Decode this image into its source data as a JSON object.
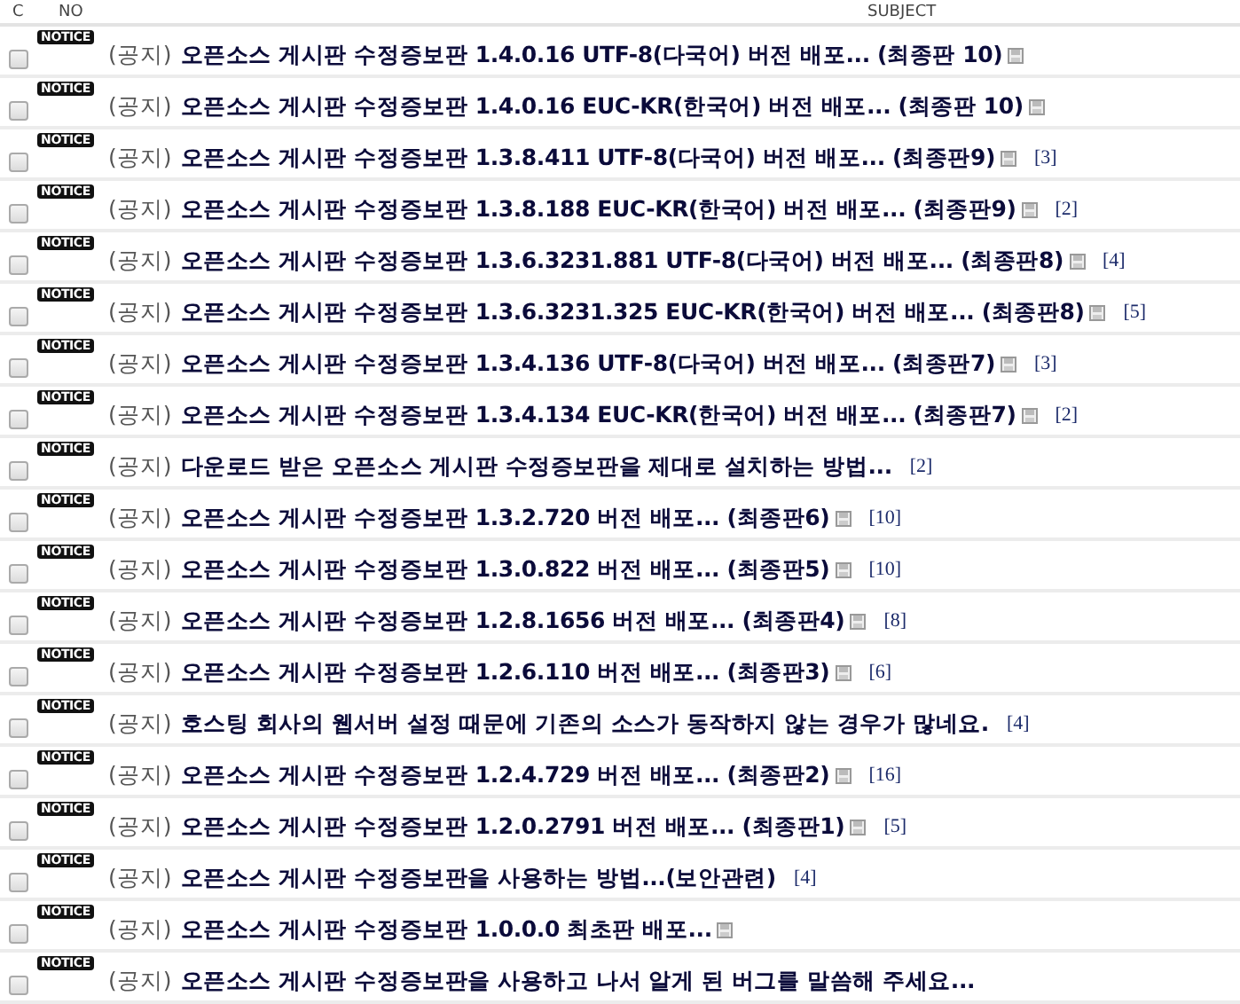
{
  "header": {
    "columns": [
      "C",
      "NO",
      "SUBJECT"
    ]
  },
  "rows": [
    {
      "checked": false,
      "badge": "NOTICE",
      "prefix": "(공지)",
      "title": "오픈소스 게시판 수정증보판 1.4.0.16 UTF-8(다국어) 버전 배포... (최종판 10)",
      "has_file": true
    },
    {
      "checked": false,
      "badge": "NOTICE",
      "prefix": "(공지)",
      "title": "오픈소스 게시판 수정증보판 1.4.0.16 EUC-KR(한국어) 버전 배포... (최종판 10)",
      "has_file": true
    },
    {
      "checked": false,
      "badge": "NOTICE",
      "prefix": "(공지)",
      "title": "오픈소스 게시판 수정증보판 1.3.8.411 UTF-8(다국어) 버전 배포... (최종판9)",
      "has_file": true,
      "comments": "[3]"
    },
    {
      "checked": false,
      "badge": "NOTICE",
      "prefix": "(공지)",
      "title": "오픈소스 게시판 수정증보판 1.3.8.188 EUC-KR(한국어) 버전 배포... (최종판9)",
      "has_file": true,
      "comments": "[2]"
    },
    {
      "checked": false,
      "badge": "NOTICE",
      "prefix": "(공지)",
      "title": "오픈소스 게시판 수정증보판 1.3.6.3231.881 UTF-8(다국어) 버전 배포... (최종판8)",
      "has_file": true,
      "comments": "[4]"
    },
    {
      "checked": false,
      "badge": "NOTICE",
      "prefix": "(공지)",
      "title": "오픈소스 게시판 수정증보판 1.3.6.3231.325 EUC-KR(한국어) 버전 배포... (최종판8)",
      "has_file": true,
      "comments": "[5]"
    },
    {
      "checked": false,
      "badge": "NOTICE",
      "prefix": "(공지)",
      "title": "오픈소스 게시판 수정증보판 1.3.4.136 UTF-8(다국어) 버전 배포... (최종판7)",
      "has_file": true,
      "comments": "[3]"
    },
    {
      "checked": false,
      "badge": "NOTICE",
      "prefix": "(공지)",
      "title": "오픈소스 게시판 수정증보판 1.3.4.134 EUC-KR(한국어) 버전 배포... (최종판7)",
      "has_file": true,
      "comments": "[2]"
    },
    {
      "checked": false,
      "badge": "NOTICE",
      "prefix": "(공지)",
      "title": "다운로드 받은 오픈소스 게시판 수정증보판을 제대로 설치하는 방법...",
      "has_file": false,
      "comments": "[2]"
    },
    {
      "checked": false,
      "badge": "NOTICE",
      "prefix": "(공지)",
      "title": "오픈소스 게시판 수정증보판 1.3.2.720 버전 배포... (최종판6)",
      "has_file": true,
      "comments": "[10]"
    },
    {
      "checked": false,
      "badge": "NOTICE",
      "prefix": "(공지)",
      "title": "오픈소스 게시판 수정증보판 1.3.0.822 버전 배포... (최종판5)",
      "has_file": true,
      "comments": "[10]"
    },
    {
      "checked": false,
      "badge": "NOTICE",
      "prefix": "(공지)",
      "title": "오픈소스 게시판 수정증보판 1.2.8.1656 버전 배포... (최종판4)",
      "has_file": true,
      "comments": "[8]"
    },
    {
      "checked": false,
      "badge": "NOTICE",
      "prefix": "(공지)",
      "title": "오픈소스 게시판 수정증보판 1.2.6.110 버전 배포... (최종판3)",
      "has_file": true,
      "comments": "[6]"
    },
    {
      "checked": false,
      "badge": "NOTICE",
      "prefix": "(공지)",
      "title": "호스팅 회사의 웹서버 설정 때문에 기존의 소스가 동작하지 않는 경우가 많네요.",
      "has_file": false,
      "comments": "[4]"
    },
    {
      "checked": false,
      "badge": "NOTICE",
      "prefix": "(공지)",
      "title": "오픈소스 게시판 수정증보판 1.2.4.729 버전 배포... (최종판2)",
      "has_file": true,
      "comments": "[16]"
    },
    {
      "checked": false,
      "badge": "NOTICE",
      "prefix": "(공지)",
      "title": "오픈소스 게시판 수정증보판 1.2.0.2791 버전 배포... (최종판1)",
      "has_file": true,
      "comments": "[5]"
    },
    {
      "checked": false,
      "badge": "NOTICE",
      "prefix": "(공지)",
      "title": "오픈소스 게시판 수정증보판을 사용하는 방법...(보안관련)",
      "has_file": false,
      "comments": "[4]"
    },
    {
      "checked": false,
      "badge": "NOTICE",
      "prefix": "(공지)",
      "title": "오픈소스 게시판 수정증보판 1.0.0.0 최초판 배포...",
      "has_file": true
    },
    {
      "checked": false,
      "badge": "NOTICE",
      "prefix": "(공지)",
      "title": "오픈소스 게시판 수정증보판을 사용하고 나서 알게 된 버그를 말씀해 주세요...",
      "has_file": false
    }
  ]
}
